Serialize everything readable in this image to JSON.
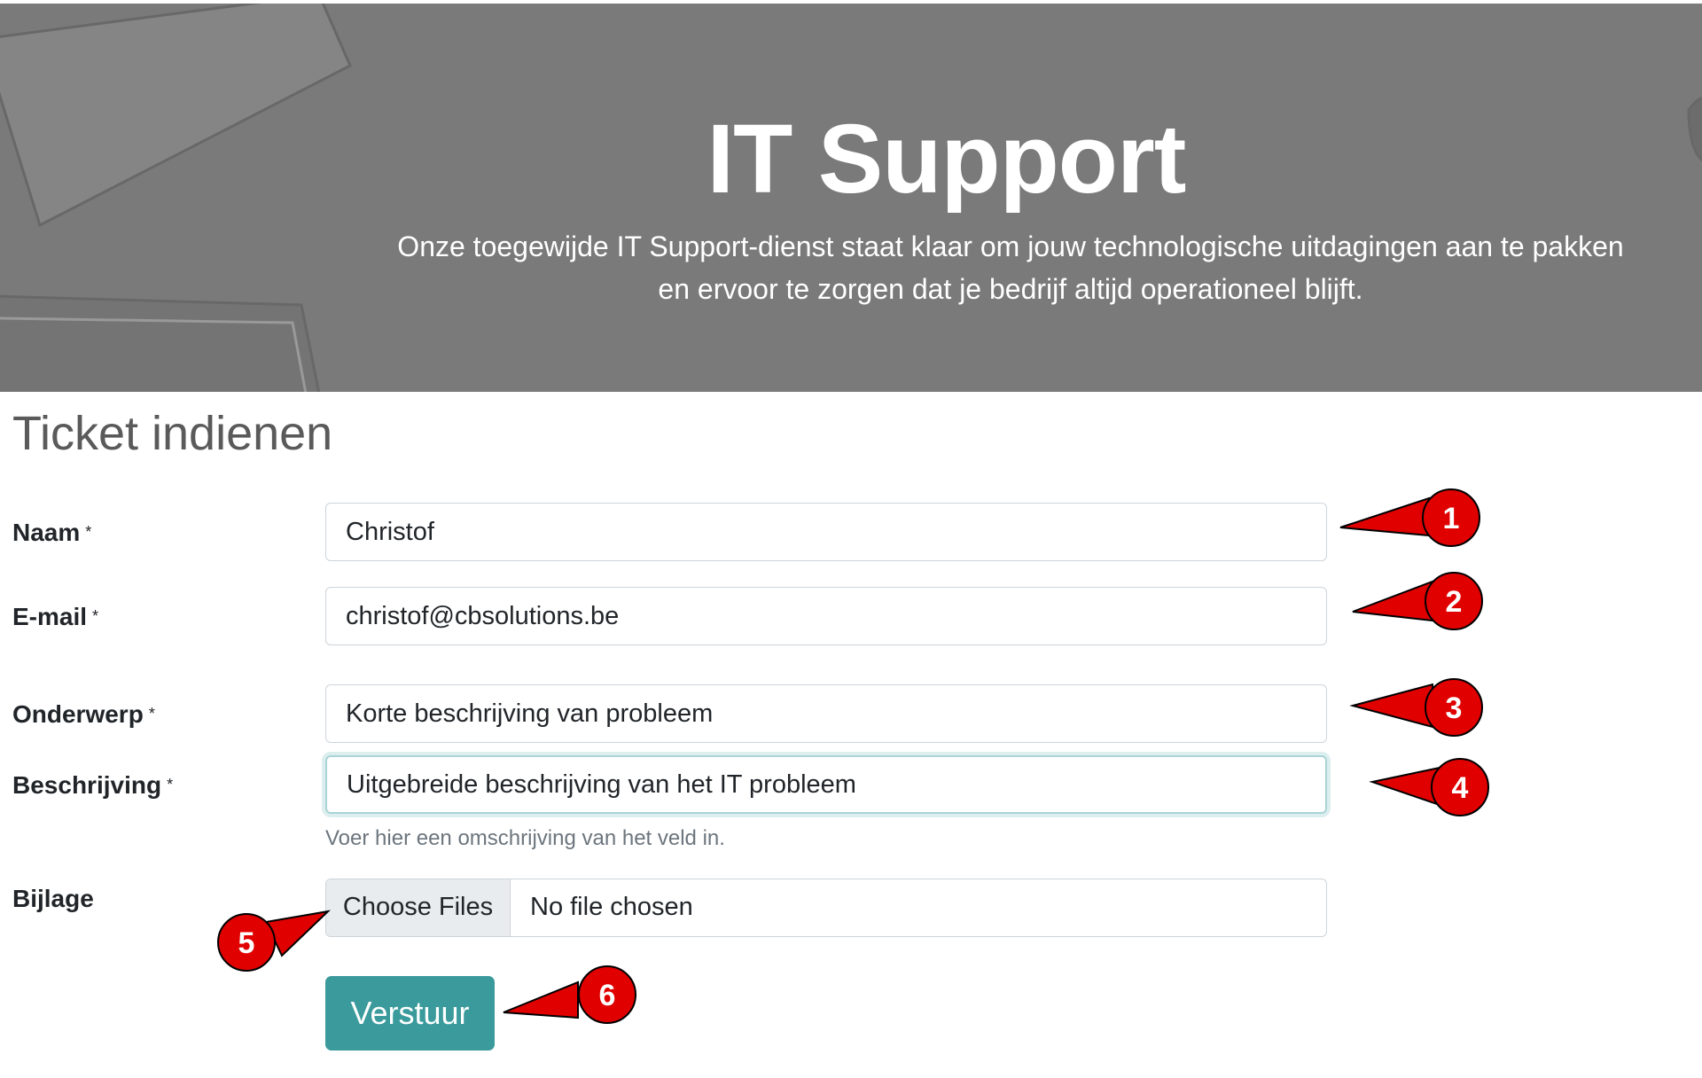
{
  "hero": {
    "title": "IT Support",
    "subtitle": "Onze toegewijde IT Support-dienst staat klaar om jouw technologische uitdagingen aan te pakken en ervoor te zorgen dat je bedrijf altijd operationeel blijft."
  },
  "form": {
    "title": "Ticket indienen",
    "required_mark": "*",
    "naam": {
      "label": "Naam",
      "value": "Christof"
    },
    "email": {
      "label": "E-mail",
      "value": "christof@cbsolutions.be"
    },
    "onderwerp": {
      "label": "Onderwerp",
      "value": "Korte beschrijving van probleem"
    },
    "beschrijving": {
      "label": "Beschrijving",
      "value": "Uitgebreide beschrijving van het IT probleem",
      "help": "Voer hier een omschrijving van het veld in."
    },
    "bijlage": {
      "label": "Bijlage",
      "button": "Choose Files",
      "status": "No file chosen"
    },
    "submit_label": "Verstuur"
  },
  "annotations": {
    "color": "#e00000",
    "markers": [
      "1",
      "2",
      "3",
      "4",
      "5",
      "6"
    ]
  }
}
